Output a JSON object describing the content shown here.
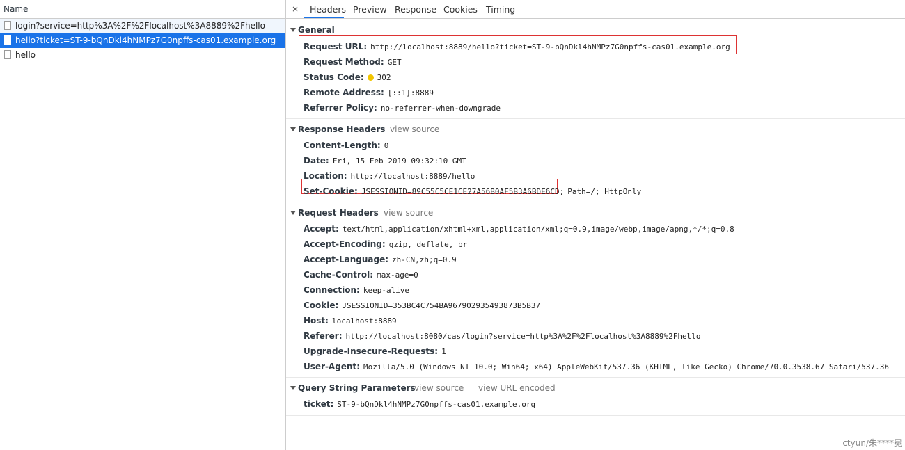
{
  "requests": {
    "header": "Name",
    "items": [
      {
        "name": "login?service=http%3A%2F%2Flocalhost%3A8889%2Fhello"
      },
      {
        "name": "hello?ticket=ST-9-bQnDkl4hNMPz7G0npffs-cas01.example.org"
      },
      {
        "name": "hello"
      }
    ]
  },
  "tabs": {
    "close": "×",
    "headers": "Headers",
    "preview": "Preview",
    "response": "Response",
    "cookies": "Cookies",
    "timing": "Timing"
  },
  "general": {
    "title": "General",
    "request_url": {
      "k": "Request URL:",
      "v": "http://localhost:8889/hello?ticket=ST-9-bQnDkl4hNMPz7G0npffs-cas01.example.org"
    },
    "request_method": {
      "k": "Request Method:",
      "v": "GET"
    },
    "status_code": {
      "k": "Status Code:",
      "v": "302"
    },
    "remote_address": {
      "k": "Remote Address:",
      "v": "[::1]:8889"
    },
    "referrer_policy": {
      "k": "Referrer Policy:",
      "v": "no-referrer-when-downgrade"
    }
  },
  "response_headers": {
    "title": "Response Headers",
    "view_source": "view source",
    "content_length": {
      "k": "Content-Length:",
      "v": "0"
    },
    "date": {
      "k": "Date:",
      "v": "Fri, 15 Feb 2019 09:32:10 GMT"
    },
    "location": {
      "k": "Location:",
      "v": "http://localhost:8889/hello"
    },
    "set_cookie": {
      "k": "Set-Cookie:",
      "v": "JSESSIONID=89C55C5CE1CE27A56B0AF5B3A6BDE6CD;",
      "rest": "Path=/; HttpOnly"
    }
  },
  "request_headers": {
    "title": "Request Headers",
    "view_source": "view source",
    "accept": {
      "k": "Accept:",
      "v": "text/html,application/xhtml+xml,application/xml;q=0.9,image/webp,image/apng,*/*;q=0.8"
    },
    "accept_encoding": {
      "k": "Accept-Encoding:",
      "v": "gzip, deflate, br"
    },
    "accept_language": {
      "k": "Accept-Language:",
      "v": "zh-CN,zh;q=0.9"
    },
    "cache_control": {
      "k": "Cache-Control:",
      "v": "max-age=0"
    },
    "connection": {
      "k": "Connection:",
      "v": "keep-alive"
    },
    "cookie": {
      "k": "Cookie:",
      "v": "JSESSIONID=353BC4C754BA967902935493873B5B37"
    },
    "host": {
      "k": "Host:",
      "v": "localhost:8889"
    },
    "referer": {
      "k": "Referer:",
      "v": "http://localhost:8080/cas/login?service=http%3A%2F%2Flocalhost%3A8889%2Fhello"
    },
    "upgrade": {
      "k": "Upgrade-Insecure-Requests:",
      "v": "1"
    },
    "user_agent": {
      "k": "User-Agent:",
      "v": "Mozilla/5.0 (Windows NT 10.0; Win64; x64) AppleWebKit/537.36 (KHTML, like Gecko) Chrome/70.0.3538.67 Safari/537.36"
    }
  },
  "query_params": {
    "title": "Query String Parameters",
    "view_source": "view source",
    "view_url_encoded": "view URL encoded",
    "ticket": {
      "k": "ticket:",
      "v": "ST-9-bQnDkl4hNMPz7G0npffs-cas01.example.org"
    }
  },
  "watermark": "ctyun/朱****冕",
  "colors": {
    "accent": "#1a73e8",
    "highlight_box": "#dd3333",
    "status_dot": "#f2c500"
  }
}
